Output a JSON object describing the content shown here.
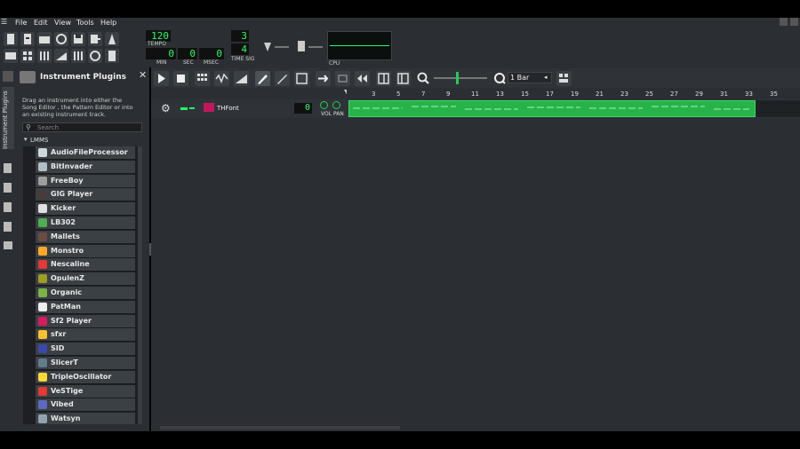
{
  "menu": {
    "items": [
      "File",
      "Edit",
      "View",
      "Tools",
      "Help"
    ]
  },
  "transport": {
    "tempo": "120",
    "tempo_label": "TEMPO",
    "min": "0",
    "min_label": "MIN",
    "sec": "0",
    "sec_label": "SEC",
    "msec": "0",
    "msec_label": "MSEC",
    "timesig_num": "3",
    "timesig_den": "4",
    "timesig_label": "TIME SIG",
    "cpu_label": "CPU"
  },
  "plugins_panel": {
    "tab_label": "Instrument Plugins",
    "title": "Instrument Plugins",
    "description": "Drag an instrument into either the Song Editor , the Pattern Editor or into an existing instrument track.",
    "search_placeholder": "Search",
    "tree_root": "LMMS",
    "plugins": [
      {
        "name": "AudioFileProcessor",
        "color": "#cfd8dc"
      },
      {
        "name": "BitInvader",
        "color": "#b0bec5"
      },
      {
        "name": "FreeBoy",
        "color": "#9e9e9e"
      },
      {
        "name": "GIG Player",
        "color": "#4a3a3a"
      },
      {
        "name": "Kicker",
        "color": "#e0e0e0"
      },
      {
        "name": "LB302",
        "color": "#4caf50"
      },
      {
        "name": "Mallets",
        "color": "#6d4c41"
      },
      {
        "name": "Monstro",
        "color": "#ffa726"
      },
      {
        "name": "Nescaline",
        "color": "#e53935"
      },
      {
        "name": "OpulenZ",
        "color": "#9e9d24"
      },
      {
        "name": "Organic",
        "color": "#7cb342"
      },
      {
        "name": "PatMan",
        "color": "#eeeeee"
      },
      {
        "name": "Sf2 Player",
        "color": "#d81b60"
      },
      {
        "name": "sfxr",
        "color": "#fbc02d"
      },
      {
        "name": "SID",
        "color": "#3949ab"
      },
      {
        "name": "SlicerT",
        "color": "#607d8b"
      },
      {
        "name": "TripleOscillator",
        "color": "#fdd835"
      },
      {
        "name": "VeSTige",
        "color": "#e53935"
      },
      {
        "name": "Vibed",
        "color": "#5c6bc0"
      },
      {
        "name": "Watsyn",
        "color": "#90a4ae"
      }
    ]
  },
  "song_editor": {
    "zoom_value": "1 Bar",
    "track": {
      "name": "THFont",
      "volume": "0",
      "vol_pan_label": "VOL PAN"
    },
    "timeline_ticks": [
      "3",
      "5",
      "7",
      "9",
      "11",
      "13",
      "15",
      "17",
      "19",
      "21",
      "23",
      "25",
      "27",
      "29",
      "31",
      "33",
      "35"
    ]
  },
  "colors": {
    "accent": "#22ff66",
    "clip": "#27b34a",
    "panel": "#2b2f33"
  }
}
